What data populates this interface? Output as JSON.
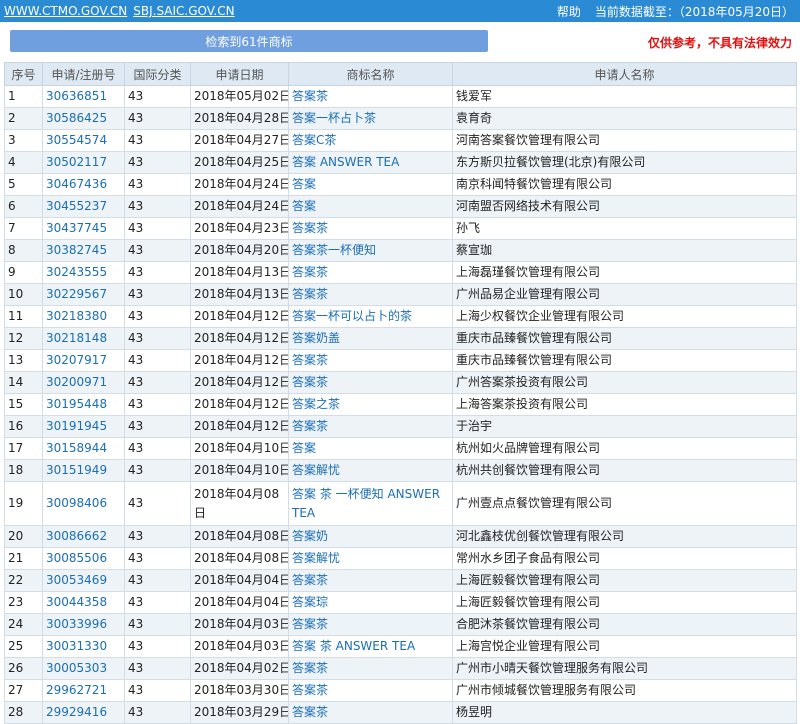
{
  "topbar": {
    "site1": "WWW.CTMO.GOV.CN",
    "site2": "SBJ.SAIC.GOV.CN",
    "help": "帮助",
    "data_date": "当前数据截至：（2018年05月20日）"
  },
  "subbar": {
    "count_label": "检索到61件商标",
    "disclaimer": "仅供参考，不具有法律效力"
  },
  "table": {
    "headers": {
      "no": "序号",
      "reg": "申请/注册号",
      "cls": "国际分类",
      "date": "申请日期",
      "mark": "商标名称",
      "applicant": "申请人名称"
    },
    "rows": [
      {
        "no": "1",
        "reg": "30636851",
        "cls": "43",
        "date": "2018年05月02日",
        "mark": "答案茶",
        "applicant": "钱爱军"
      },
      {
        "no": "2",
        "reg": "30586425",
        "cls": "43",
        "date": "2018年04月28日",
        "mark": "答案一杯占卜茶",
        "applicant": "袁育奇"
      },
      {
        "no": "3",
        "reg": "30554574",
        "cls": "43",
        "date": "2018年04月27日",
        "mark": "答案C茶",
        "applicant": "河南答案餐饮管理有限公司"
      },
      {
        "no": "4",
        "reg": "30502117",
        "cls": "43",
        "date": "2018年04月25日",
        "mark": "答案 ANSWER TEA",
        "applicant": "东方斯贝拉餐饮管理(北京)有限公司"
      },
      {
        "no": "5",
        "reg": "30467436",
        "cls": "43",
        "date": "2018年04月24日",
        "mark": "答案",
        "applicant": "南京科闻特餐饮管理有限公司"
      },
      {
        "no": "6",
        "reg": "30455237",
        "cls": "43",
        "date": "2018年04月24日",
        "mark": "答案",
        "applicant": "河南盟否网络技术有限公司"
      },
      {
        "no": "7",
        "reg": "30437745",
        "cls": "43",
        "date": "2018年04月23日",
        "mark": "答案茶",
        "applicant": "孙飞"
      },
      {
        "no": "8",
        "reg": "30382745",
        "cls": "43",
        "date": "2018年04月20日",
        "mark": "答案茶一杯便知",
        "applicant": "蔡宣珈"
      },
      {
        "no": "9",
        "reg": "30243555",
        "cls": "43",
        "date": "2018年04月13日",
        "mark": "答案茶",
        "applicant": "上海磊瑾餐饮管理有限公司"
      },
      {
        "no": "10",
        "reg": "30229567",
        "cls": "43",
        "date": "2018年04月13日",
        "mark": "答案茶",
        "applicant": "广州品易企业管理有限公司"
      },
      {
        "no": "11",
        "reg": "30218380",
        "cls": "43",
        "date": "2018年04月12日",
        "mark": "答案一杯可以占卜的茶",
        "applicant": "上海少权餐饮企业管理有限公司"
      },
      {
        "no": "12",
        "reg": "30218148",
        "cls": "43",
        "date": "2018年04月12日",
        "mark": "答案奶盖",
        "applicant": "重庆市品臻餐饮管理有限公司"
      },
      {
        "no": "13",
        "reg": "30207917",
        "cls": "43",
        "date": "2018年04月12日",
        "mark": "答案茶",
        "applicant": "重庆市品臻餐饮管理有限公司"
      },
      {
        "no": "14",
        "reg": "30200971",
        "cls": "43",
        "date": "2018年04月12日",
        "mark": "答案茶",
        "applicant": "广州答案茶投资有限公司"
      },
      {
        "no": "15",
        "reg": "30195448",
        "cls": "43",
        "date": "2018年04月12日",
        "mark": "答案之茶",
        "applicant": "上海答案茶投资有限公司"
      },
      {
        "no": "16",
        "reg": "30191945",
        "cls": "43",
        "date": "2018年04月12日",
        "mark": "答案茶",
        "applicant": "于治宇"
      },
      {
        "no": "17",
        "reg": "30158944",
        "cls": "43",
        "date": "2018年04月10日",
        "mark": "答案",
        "applicant": "杭州如火品牌管理有限公司"
      },
      {
        "no": "18",
        "reg": "30151949",
        "cls": "43",
        "date": "2018年04月10日",
        "mark": "答案解忧",
        "applicant": "杭州共创餐饮管理有限公司"
      },
      {
        "no": "19",
        "reg": "30098406",
        "cls": "43",
        "date": "2018年04月08日",
        "mark": "答案 茶 一杯便知 ANSWER TEA",
        "applicant": "广州壹点点餐饮管理有限公司"
      },
      {
        "no": "20",
        "reg": "30086662",
        "cls": "43",
        "date": "2018年04月08日",
        "mark": "答案奶",
        "applicant": "河北鑫枝优创餐饮管理有限公司"
      },
      {
        "no": "21",
        "reg": "30085506",
        "cls": "43",
        "date": "2018年04月08日",
        "mark": "答案解忧",
        "applicant": "常州水乡团子食品有限公司"
      },
      {
        "no": "22",
        "reg": "30053469",
        "cls": "43",
        "date": "2018年04月04日",
        "mark": "答案茶",
        "applicant": "上海匠毅餐饮管理有限公司"
      },
      {
        "no": "23",
        "reg": "30044358",
        "cls": "43",
        "date": "2018年04月04日",
        "mark": "答案琮",
        "applicant": "上海匠毅餐饮管理有限公司"
      },
      {
        "no": "24",
        "reg": "30033996",
        "cls": "43",
        "date": "2018年04月03日",
        "mark": "答案茶",
        "applicant": "合肥沐茶餐饮管理有限公司"
      },
      {
        "no": "25",
        "reg": "30031330",
        "cls": "43",
        "date": "2018年04月03日",
        "mark": "答案 茶 ANSWER TEA",
        "applicant": "上海宫悦企业管理有限公司"
      },
      {
        "no": "26",
        "reg": "30005303",
        "cls": "43",
        "date": "2018年04月02日",
        "mark": "答案茶",
        "applicant": "广州市小晴天餐饮管理服务有限公司"
      },
      {
        "no": "27",
        "reg": "29962721",
        "cls": "43",
        "date": "2018年03月30日",
        "mark": "答案茶",
        "applicant": "广州市倾城餐饮管理服务有限公司"
      },
      {
        "no": "28",
        "reg": "29929416",
        "cls": "43",
        "date": "2018年03月29日",
        "mark": "答案茶",
        "applicant": "杨昱明"
      }
    ]
  }
}
